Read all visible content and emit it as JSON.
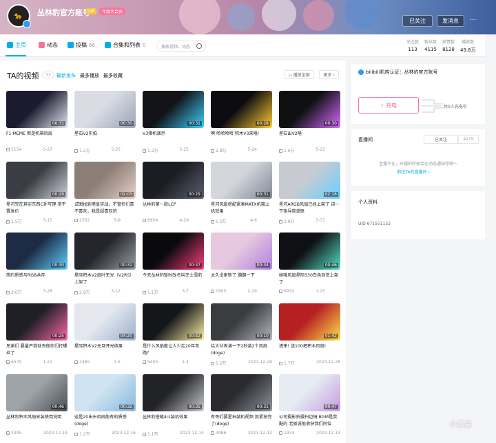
{
  "header": {
    "username": "丛林豹官方账号",
    "level": "LV6",
    "vip_badge": "年度大会员",
    "follow_label": "已关注",
    "message_label": "发消息",
    "more_label": "···"
  },
  "nav": {
    "items": [
      {
        "label": "主页",
        "count": ""
      },
      {
        "label": "动态",
        "count": ""
      },
      {
        "label": "投稿",
        "count": "66"
      },
      {
        "label": "合集和列表",
        "count": "0"
      }
    ],
    "search_placeholder": "搜索视频、动态",
    "stats": [
      {
        "label": "关注数",
        "value": "113"
      },
      {
        "label": "粉丝数",
        "value": "4115"
      },
      {
        "label": "获赞数",
        "value": "8128"
      },
      {
        "label": "播放数",
        "value": "49.8万"
      }
    ]
  },
  "videos_section": {
    "title": "TA的视频",
    "count": "33",
    "sort_tabs": [
      "最新发布",
      "最多播放",
      "最多收藏"
    ],
    "play_all": "▷ 播放全部",
    "more": "更多 ›"
  },
  "videos": [
    {
      "title": "F1 MEME 但是机箱风扇",
      "duration": "00:31",
      "views": "5154",
      "date": "5-27"
    },
    {
      "title": "星石V2实拍",
      "duration": "00:30",
      "views": "1.2万",
      "date": "5-25"
    },
    {
      "title": "V3猎机演示",
      "duration": "00:31",
      "views": "1.2万",
      "date": "5-25"
    },
    {
      "title": "啊 哈哈哈哈 积木V3来咯!",
      "duration": "00:28",
      "views": "2.8万",
      "date": "5-24"
    },
    {
      "title": "星石出V2咯",
      "duration": "00:30",
      "views": "1.6万",
      "date": "5-23"
    },
    {
      "title": "星河完在其实东西C补写理 拵平置发价",
      "duration": "00:29",
      "views": "1.5万",
      "date": "5-15"
    },
    {
      "title": "试图找到用皇实战，不管你们喜不喜欢，我是超喜欢的",
      "duration": "02:03",
      "views": "2502",
      "date": "5-9"
    },
    {
      "title": "丛林豹第一款LCP",
      "duration": "00:29",
      "views": "6954",
      "date": "4-29"
    },
    {
      "title": "星河风扇搭配紧凑MATX机箱上机效果",
      "duration": "00:31",
      "views": "1.2万",
      "date": "4-6"
    },
    {
      "title": "星河ARGB风扇已经上架了 讲一下指导简单联",
      "duration": "02:16",
      "views": "2.8万",
      "date": "3-31"
    },
    {
      "title": "简约质感与RGB共存",
      "duration": "00:30",
      "views": "2.6万",
      "date": "3-28"
    },
    {
      "title": "星际积木V2扇叶无光（V2RS）上架了",
      "duration": "00:31",
      "views": "2.9万",
      "date": "3-12"
    },
    {
      "title": "今天丛林豹暂时改名叫芝士雪豹",
      "duration": "00:37",
      "views": "1.1万",
      "date": "3-7"
    },
    {
      "title": "太久没更新了 蹦蹦一下",
      "duration": "00:34",
      "views": "1905",
      "date": "2-29"
    },
    {
      "title": "碰哦风扇星际S30白色到货上架了",
      "duration": "00:46",
      "views": "6932",
      "date": "1-25"
    },
    {
      "title": "兄弟们 要量产我就去做你们打螺丝了",
      "duration": "00:25",
      "views": "6579",
      "date": "1-21"
    },
    {
      "title": "星际积木V2元旦开光结果",
      "duration": "04:20",
      "views": "2465",
      "date": "1-5"
    },
    {
      "title": "是什么风扇能让人少走20年弯路？",
      "duration": "00:42",
      "views": "9405",
      "date": "1-4"
    },
    {
      "title": "给大伙表演一下2秒装2个风扇(doge)",
      "duration": "00:10",
      "views": "1.2万",
      "date": "2023-12-28"
    },
    {
      "title": "进来! 送100把积木风扇!",
      "duration": "01:42",
      "views": "1.7万",
      "date": "2023-12-28"
    },
    {
      "title": "丛林豹积木风扇安装使用说明",
      "duration": "00:46",
      "views": "3395",
      "date": "2023-12-19"
    },
    {
      "title": "这是20出头风扇能有的质感(doge)",
      "duration": "00:32",
      "views": "1.2万",
      "date": "2023-12-16"
    },
    {
      "title": "丛林豹搭载4rs装机效果",
      "duration": "00:35",
      "views": "1.1万",
      "date": "2023-12-14"
    },
    {
      "title": "有哥们要星石装机视频 抓紧拍完了(doge)",
      "duration": "00:31",
      "views": "3986",
      "date": "2023-12-13"
    },
    {
      "title": "公司摄影拍摄扫边镜 BGM是我配的 老板说能收获我们同位",
      "duration": "00:47",
      "views": "1933",
      "date": "2023-12-13"
    }
  ],
  "sidebar": {
    "verification": "bilibili机构认证：丛林豹官方账号",
    "charge_label": "⚡ 充电",
    "charge_count": "共0人充电中",
    "live_title": "直播间",
    "live_follow": "已关注",
    "live_num": "4115",
    "live_message": "主播不在，开播的时候会在动态通知你嘀～",
    "live_link": "前往TA的直播间 ›",
    "profile_title": "个人资料",
    "uid": "UID  671551152"
  },
  "watermark": "小黑盒",
  "colors": {
    "accent": "#00aeec",
    "pink": "#fb7299",
    "gold": "#f7c53d"
  }
}
